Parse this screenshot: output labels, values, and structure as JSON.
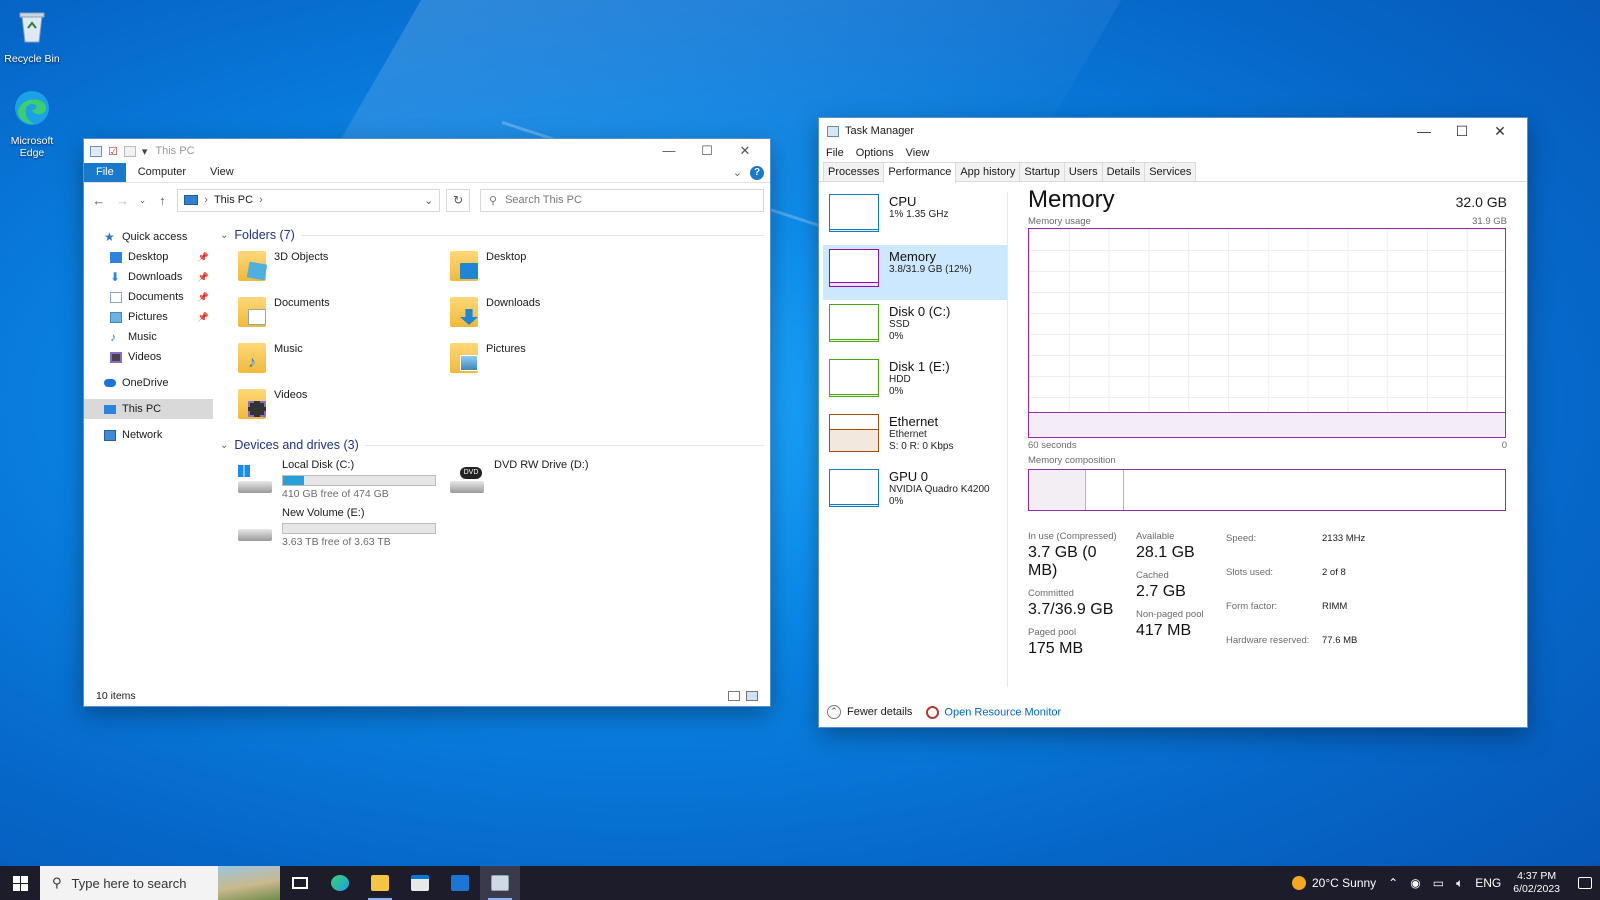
{
  "desktop": {
    "icons": [
      {
        "label": "Recycle Bin"
      },
      {
        "label": "Microsoft Edge"
      }
    ]
  },
  "explorer": {
    "title": "This PC",
    "ribbon_tabs": [
      "File",
      "Computer",
      "View"
    ],
    "address": "This PC",
    "search_placeholder": "Search This PC",
    "sidebar": {
      "quick_access": "Quick access",
      "items": [
        "Desktop",
        "Downloads",
        "Documents",
        "Pictures",
        "Music",
        "Videos"
      ],
      "onedrive": "OneDrive",
      "this_pc": "This PC",
      "network": "Network"
    },
    "folders_header": "Folders (7)",
    "folders": [
      "3D Objects",
      "Desktop",
      "Documents",
      "Downloads",
      "Music",
      "Pictures",
      "Videos"
    ],
    "drives_header": "Devices and drives (3)",
    "drives": [
      {
        "name": "Local Disk (C:)",
        "free": "410 GB free of 474 GB",
        "used_fraction": 0.135
      },
      {
        "name": "DVD RW Drive (D:)"
      },
      {
        "name": "New Volume (E:)",
        "free": "3.63 TB free of 3.63 TB",
        "used_fraction": 0.0
      }
    ],
    "status": "10 items"
  },
  "taskmgr": {
    "title": "Task Manager",
    "menu": [
      "File",
      "Options",
      "View"
    ],
    "tabs": [
      "Processes",
      "Performance",
      "App history",
      "Startup",
      "Users",
      "Details",
      "Services"
    ],
    "active_tab": "Performance",
    "side": [
      {
        "name": "CPU",
        "sub1": "1% 1.35 GHz",
        "sub2": "",
        "color": "#117dbb"
      },
      {
        "name": "Memory",
        "sub1": "3.8/31.9 GB (12%)",
        "sub2": "",
        "color": "#8b12ae"
      },
      {
        "name": "Disk 0 (C:)",
        "sub1": "SSD",
        "sub2": "0%",
        "color": "#4da60c"
      },
      {
        "name": "Disk 1 (E:)",
        "sub1": "HDD",
        "sub2": "0%",
        "color": "#4da60c"
      },
      {
        "name": "Ethernet",
        "sub1": "Ethernet",
        "sub2": "S: 0 R: 0 Kbps",
        "color": "#a74f01"
      },
      {
        "name": "GPU 0",
        "sub1": "NVIDIA Quadro K4200",
        "sub2": "0%",
        "color": "#117dbb"
      }
    ],
    "memory": {
      "heading": "Memory",
      "total": "32.0 GB",
      "usage_label": "Memory usage",
      "usage_max": "31.9 GB",
      "usage_fraction": 0.12,
      "time_label": "60 seconds",
      "time_zero": "0",
      "composition_label": "Memory composition",
      "in_use_label": "In use (Compressed)",
      "in_use": "3.7 GB (0 MB)",
      "available_label": "Available",
      "available": "28.1 GB",
      "committed_label": "Committed",
      "committed": "3.7/36.9 GB",
      "cached_label": "Cached",
      "cached": "2.7 GB",
      "paged_label": "Paged pool",
      "paged": "175 MB",
      "nonpaged_label": "Non-paged pool",
      "nonpaged": "417 MB",
      "specs": [
        {
          "k": "Speed:",
          "v": "2133 MHz"
        },
        {
          "k": "Slots used:",
          "v": "2 of 8"
        },
        {
          "k": "Form factor:",
          "v": "RIMM"
        },
        {
          "k": "Hardware reserved:",
          "v": "77.6 MB"
        }
      ]
    },
    "footer": {
      "fewer": "Fewer details",
      "resmon": "Open Resource Monitor"
    }
  },
  "taskbar": {
    "search_placeholder": "Type here to search",
    "weather": "20°C  Sunny",
    "lang": "ENG",
    "time": "4:37 PM",
    "date": "6/02/2023"
  }
}
